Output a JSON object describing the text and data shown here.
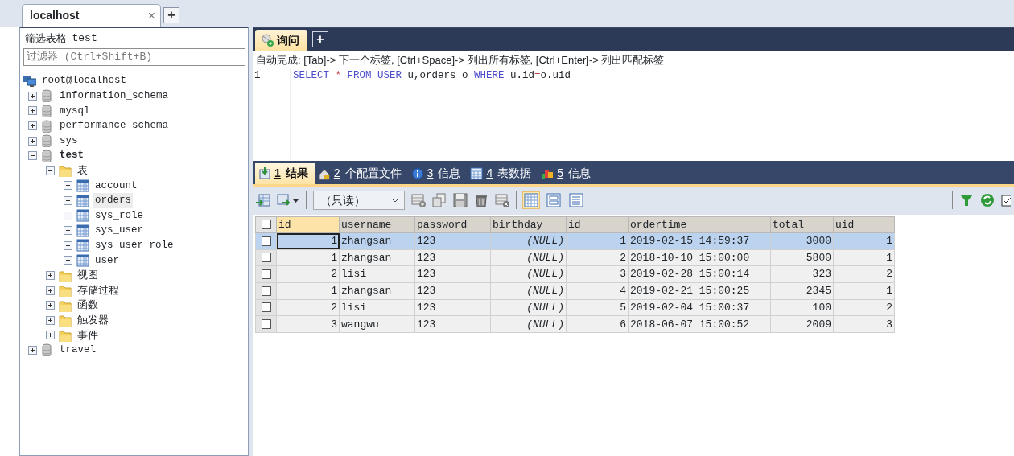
{
  "connection_tabs": [
    {
      "label": "localhost",
      "selected": true,
      "close": "×"
    }
  ],
  "add_connection": "+",
  "sidebar": {
    "title": "筛选表格",
    "database": "test",
    "filter_placeholder": "过滤器 (Ctrl+Shift+B)",
    "tree": [
      {
        "label": "root@localhost",
        "kind": "server",
        "selected": false,
        "children": [
          {
            "label": "information_schema",
            "kind": "database",
            "expanded": false,
            "current": false,
            "selected": false
          },
          {
            "label": "mysql",
            "kind": "database",
            "expanded": false,
            "current": false,
            "selected": false
          },
          {
            "label": "performance_schema",
            "kind": "database",
            "expanded": false,
            "current": false,
            "selected": false
          },
          {
            "label": "sys",
            "kind": "database",
            "expanded": false,
            "current": false,
            "selected": false
          },
          {
            "label": "test",
            "kind": "database",
            "expanded": true,
            "current": true,
            "selected": false,
            "children": [
              {
                "label": "表",
                "kind": "folder",
                "expanded": true,
                "selected": false,
                "children": [
                  {
                    "label": "account",
                    "kind": "table",
                    "expanded": false,
                    "selected": false
                  },
                  {
                    "label": "orders",
                    "kind": "table",
                    "expanded": false,
                    "selected": true
                  },
                  {
                    "label": "sys_role",
                    "kind": "table",
                    "expanded": false,
                    "selected": false
                  },
                  {
                    "label": "sys_user",
                    "kind": "table",
                    "expanded": false,
                    "selected": false
                  },
                  {
                    "label": "sys_user_role",
                    "kind": "table",
                    "expanded": false,
                    "selected": false
                  },
                  {
                    "label": "user",
                    "kind": "table",
                    "expanded": false,
                    "selected": false
                  }
                ]
              },
              {
                "label": "视图",
                "kind": "folder",
                "expanded": false,
                "selected": false
              },
              {
                "label": "存储过程",
                "kind": "folder",
                "expanded": false,
                "selected": false
              },
              {
                "label": "函数",
                "kind": "folder",
                "expanded": false,
                "selected": false
              },
              {
                "label": "触发器",
                "kind": "folder",
                "expanded": false,
                "selected": false
              },
              {
                "label": "事件",
                "kind": "folder",
                "expanded": false,
                "selected": false
              }
            ]
          },
          {
            "label": "travel",
            "kind": "database",
            "expanded": false,
            "current": false,
            "selected": false
          }
        ]
      }
    ]
  },
  "query_tabs": [
    {
      "label": "询问",
      "selected": true
    }
  ],
  "add_query": "+",
  "autocomplete_hint": "自动完成: [Tab]-> 下一个标签, [Ctrl+Space]-> 列出所有标签, [Ctrl+Enter]-> 列出匹配标签",
  "editor": {
    "line_number": "1",
    "tokens": [
      {
        "text": "SELECT",
        "kind": "keyword"
      },
      {
        "text": " * ",
        "kind": "operator"
      },
      {
        "text": "FROM USER",
        "kind": "keyword"
      },
      {
        "text": " u,orders o ",
        "kind": "plain"
      },
      {
        "text": "WHERE",
        "kind": "keyword"
      },
      {
        "text": " u.id",
        "kind": "plain"
      },
      {
        "text": "=",
        "kind": "operator"
      },
      {
        "text": "o.uid",
        "kind": "plain"
      }
    ]
  },
  "result_tabs": [
    {
      "number": "1",
      "label": "结果",
      "selected": true
    },
    {
      "number": "2",
      "label": "个配置文件",
      "selected": false
    },
    {
      "number": "3",
      "label": "信息",
      "selected": false
    },
    {
      "number": "4",
      "label": "表数据",
      "selected": false
    },
    {
      "number": "5",
      "label": "信息",
      "selected": false
    }
  ],
  "toolbar": {
    "mode": "（只读）"
  },
  "table": {
    "all_checked": false,
    "columns": [
      {
        "label": "id",
        "selected": true
      },
      {
        "label": "username",
        "selected": false
      },
      {
        "label": "password",
        "selected": false
      },
      {
        "label": "birthday",
        "selected": false
      },
      {
        "label": "id",
        "selected": false
      },
      {
        "label": "ordertime",
        "selected": false
      },
      {
        "label": "total",
        "selected": false
      },
      {
        "label": "uid",
        "selected": false
      }
    ],
    "rows": [
      {
        "selected": true,
        "checked": false,
        "cells": [
          "1",
          "zhangsan",
          "123",
          "(NULL)",
          "1",
          "2019-02-15 14:59:37",
          "3000",
          "1"
        ]
      },
      {
        "selected": false,
        "checked": false,
        "cells": [
          "1",
          "zhangsan",
          "123",
          "(NULL)",
          "2",
          "2018-10-10 15:00:00",
          "5800",
          "1"
        ]
      },
      {
        "selected": false,
        "checked": false,
        "cells": [
          "2",
          "lisi",
          "123",
          "(NULL)",
          "3",
          "2019-02-28 15:00:14",
          "323",
          "2"
        ]
      },
      {
        "selected": false,
        "checked": false,
        "cells": [
          "1",
          "zhangsan",
          "123",
          "(NULL)",
          "4",
          "2019-02-21 15:00:25",
          "2345",
          "1"
        ]
      },
      {
        "selected": false,
        "checked": false,
        "cells": [
          "2",
          "lisi",
          "123",
          "(NULL)",
          "5",
          "2019-02-04 15:00:37",
          "100",
          "2"
        ]
      },
      {
        "selected": false,
        "checked": false,
        "cells": [
          "3",
          "wangwu",
          "123",
          "(NULL)",
          "6",
          "2018-06-07 15:00:52",
          "2009",
          "3"
        ]
      }
    ]
  }
}
